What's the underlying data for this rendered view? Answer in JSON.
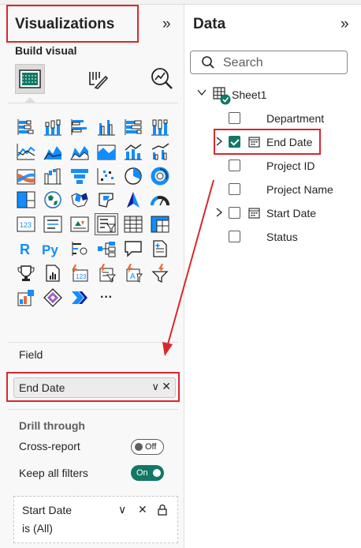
{
  "visualizations": {
    "title": "Visualizations",
    "collapse_glyph": "»",
    "build_visual_label": "Build visual",
    "mode_tabs": [
      "build-visual-icon",
      "format-visual-icon",
      "analytics-icon"
    ],
    "more_visuals": "···",
    "field_section": {
      "label": "Field",
      "value": "End Date",
      "chevron": "∨",
      "remove": "✕"
    },
    "drill_through": {
      "label": "Drill through",
      "cross_report_label": "Cross-report",
      "cross_report_state": "Off",
      "keep_filters_label": "Keep all filters",
      "keep_filters_state": "On"
    },
    "filter_card": {
      "field": "Start Date",
      "summary": "is (All)",
      "chevron": "∨",
      "remove": "✕",
      "lock": "lock-icon"
    }
  },
  "data": {
    "title": "Data",
    "collapse_glyph": "»",
    "search_placeholder": "Search",
    "table": {
      "name": "Sheet1",
      "expanded": true
    },
    "fields": [
      {
        "label": "Department",
        "checked": false,
        "expandable": false,
        "is_date": false
      },
      {
        "label": "End Date",
        "checked": true,
        "expandable": true,
        "is_date": true
      },
      {
        "label": "Project ID",
        "checked": false,
        "expandable": false,
        "is_date": false
      },
      {
        "label": "Project Name",
        "checked": false,
        "expandable": false,
        "is_date": false
      },
      {
        "label": "Start Date",
        "checked": false,
        "expandable": true,
        "is_date": true
      },
      {
        "label": "Status",
        "checked": false,
        "expandable": false,
        "is_date": false
      }
    ]
  },
  "colors": {
    "highlight_red": "#d9272e",
    "toggle_on": "#117865",
    "checkbox_checked": "#117865",
    "chart_blue": "#118dff",
    "chart_navy": "#12239e",
    "chart_orange": "#e66c37",
    "text": "#252423"
  }
}
